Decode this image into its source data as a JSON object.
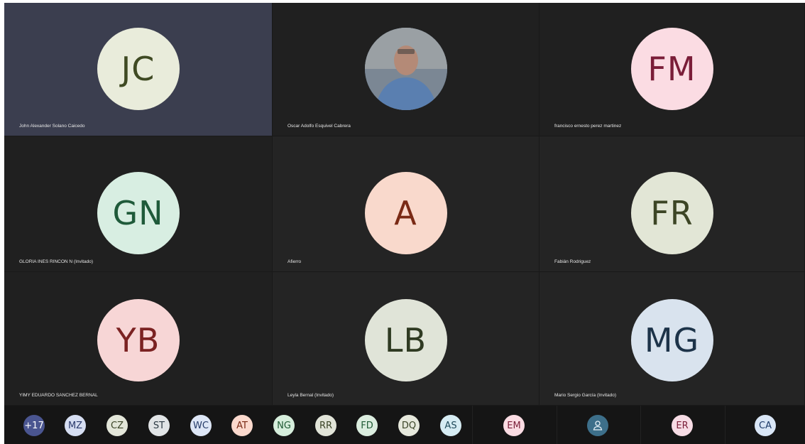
{
  "tiles": [
    {
      "initials": "JC",
      "name": "John Alexander Solano Caicedo",
      "bg": "#e9ecdb",
      "fg": "#3f4a23"
    },
    {
      "initials": "",
      "name": "Oscar Adolfo Esquivel Cabrera",
      "photo": true
    },
    {
      "initials": "FM",
      "name": "francisco ernesto perez martinez",
      "bg": "#fbdce3",
      "fg": "#7a1d38"
    },
    {
      "initials": "GN",
      "name": "GLORIA INES RINCON N (Invitado)",
      "bg": "#d8eee2",
      "fg": "#1f5a3a"
    },
    {
      "initials": "A",
      "name": "Afierro",
      "bg": "#f9d9cc",
      "fg": "#7a2a15"
    },
    {
      "initials": "FR",
      "name": "Fabián Rodriguez",
      "bg": "#e2e6d6",
      "fg": "#3c4525"
    },
    {
      "initials": "YB",
      "name": "YIMY EDUARDO SANCHEZ BERNAL",
      "bg": "#f7d6d6",
      "fg": "#7b2222"
    },
    {
      "initials": "LB",
      "name": "Leyla Bernal (Invitado)",
      "bg": "#e0e4d8",
      "fg": "#2f3a22"
    },
    {
      "initials": "MG",
      "name": "Mario Sergio García (Invitado)",
      "bg": "#d9e3ee",
      "fg": "#1d3349"
    }
  ],
  "tray": [
    {
      "label": "+17",
      "bg": "#4a5590",
      "fg": "#ffffff"
    },
    {
      "label": "MZ",
      "bg": "#d6def2",
      "fg": "#2a3a6c"
    },
    {
      "label": "CZ",
      "bg": "#e3e6d9",
      "fg": "#3a4426"
    },
    {
      "label": "ST",
      "bg": "#e1e4e6",
      "fg": "#2c3a44"
    },
    {
      "label": "WC",
      "bg": "#dde6f6",
      "fg": "#243a68"
    },
    {
      "label": "AT",
      "bg": "#fbd9cd",
      "fg": "#7a2a15"
    },
    {
      "label": "NG",
      "bg": "#d6eedc",
      "fg": "#1f5a34"
    },
    {
      "label": "RR",
      "bg": "#e1e4d8",
      "fg": "#3a4426"
    },
    {
      "label": "FD",
      "bg": "#dbeddf",
      "fg": "#1f5a34"
    },
    {
      "label": "DQ",
      "bg": "#e6e8dc",
      "fg": "#3a4426"
    },
    {
      "label": "AS",
      "bg": "#d6ecf3",
      "fg": "#1f4a5a"
    },
    {
      "label": "EM",
      "bg": "#fbdce3",
      "fg": "#7a1d38"
    },
    {
      "label": "",
      "icon": "person-icon",
      "bg": "#3d6f8a",
      "fg": "#e8f2f8"
    },
    {
      "label": "ER",
      "bg": "#f7dce5",
      "fg": "#7a1d38"
    },
    {
      "label": "CA",
      "bg": "#d9e6f6",
      "fg": "#1d3a68"
    }
  ]
}
